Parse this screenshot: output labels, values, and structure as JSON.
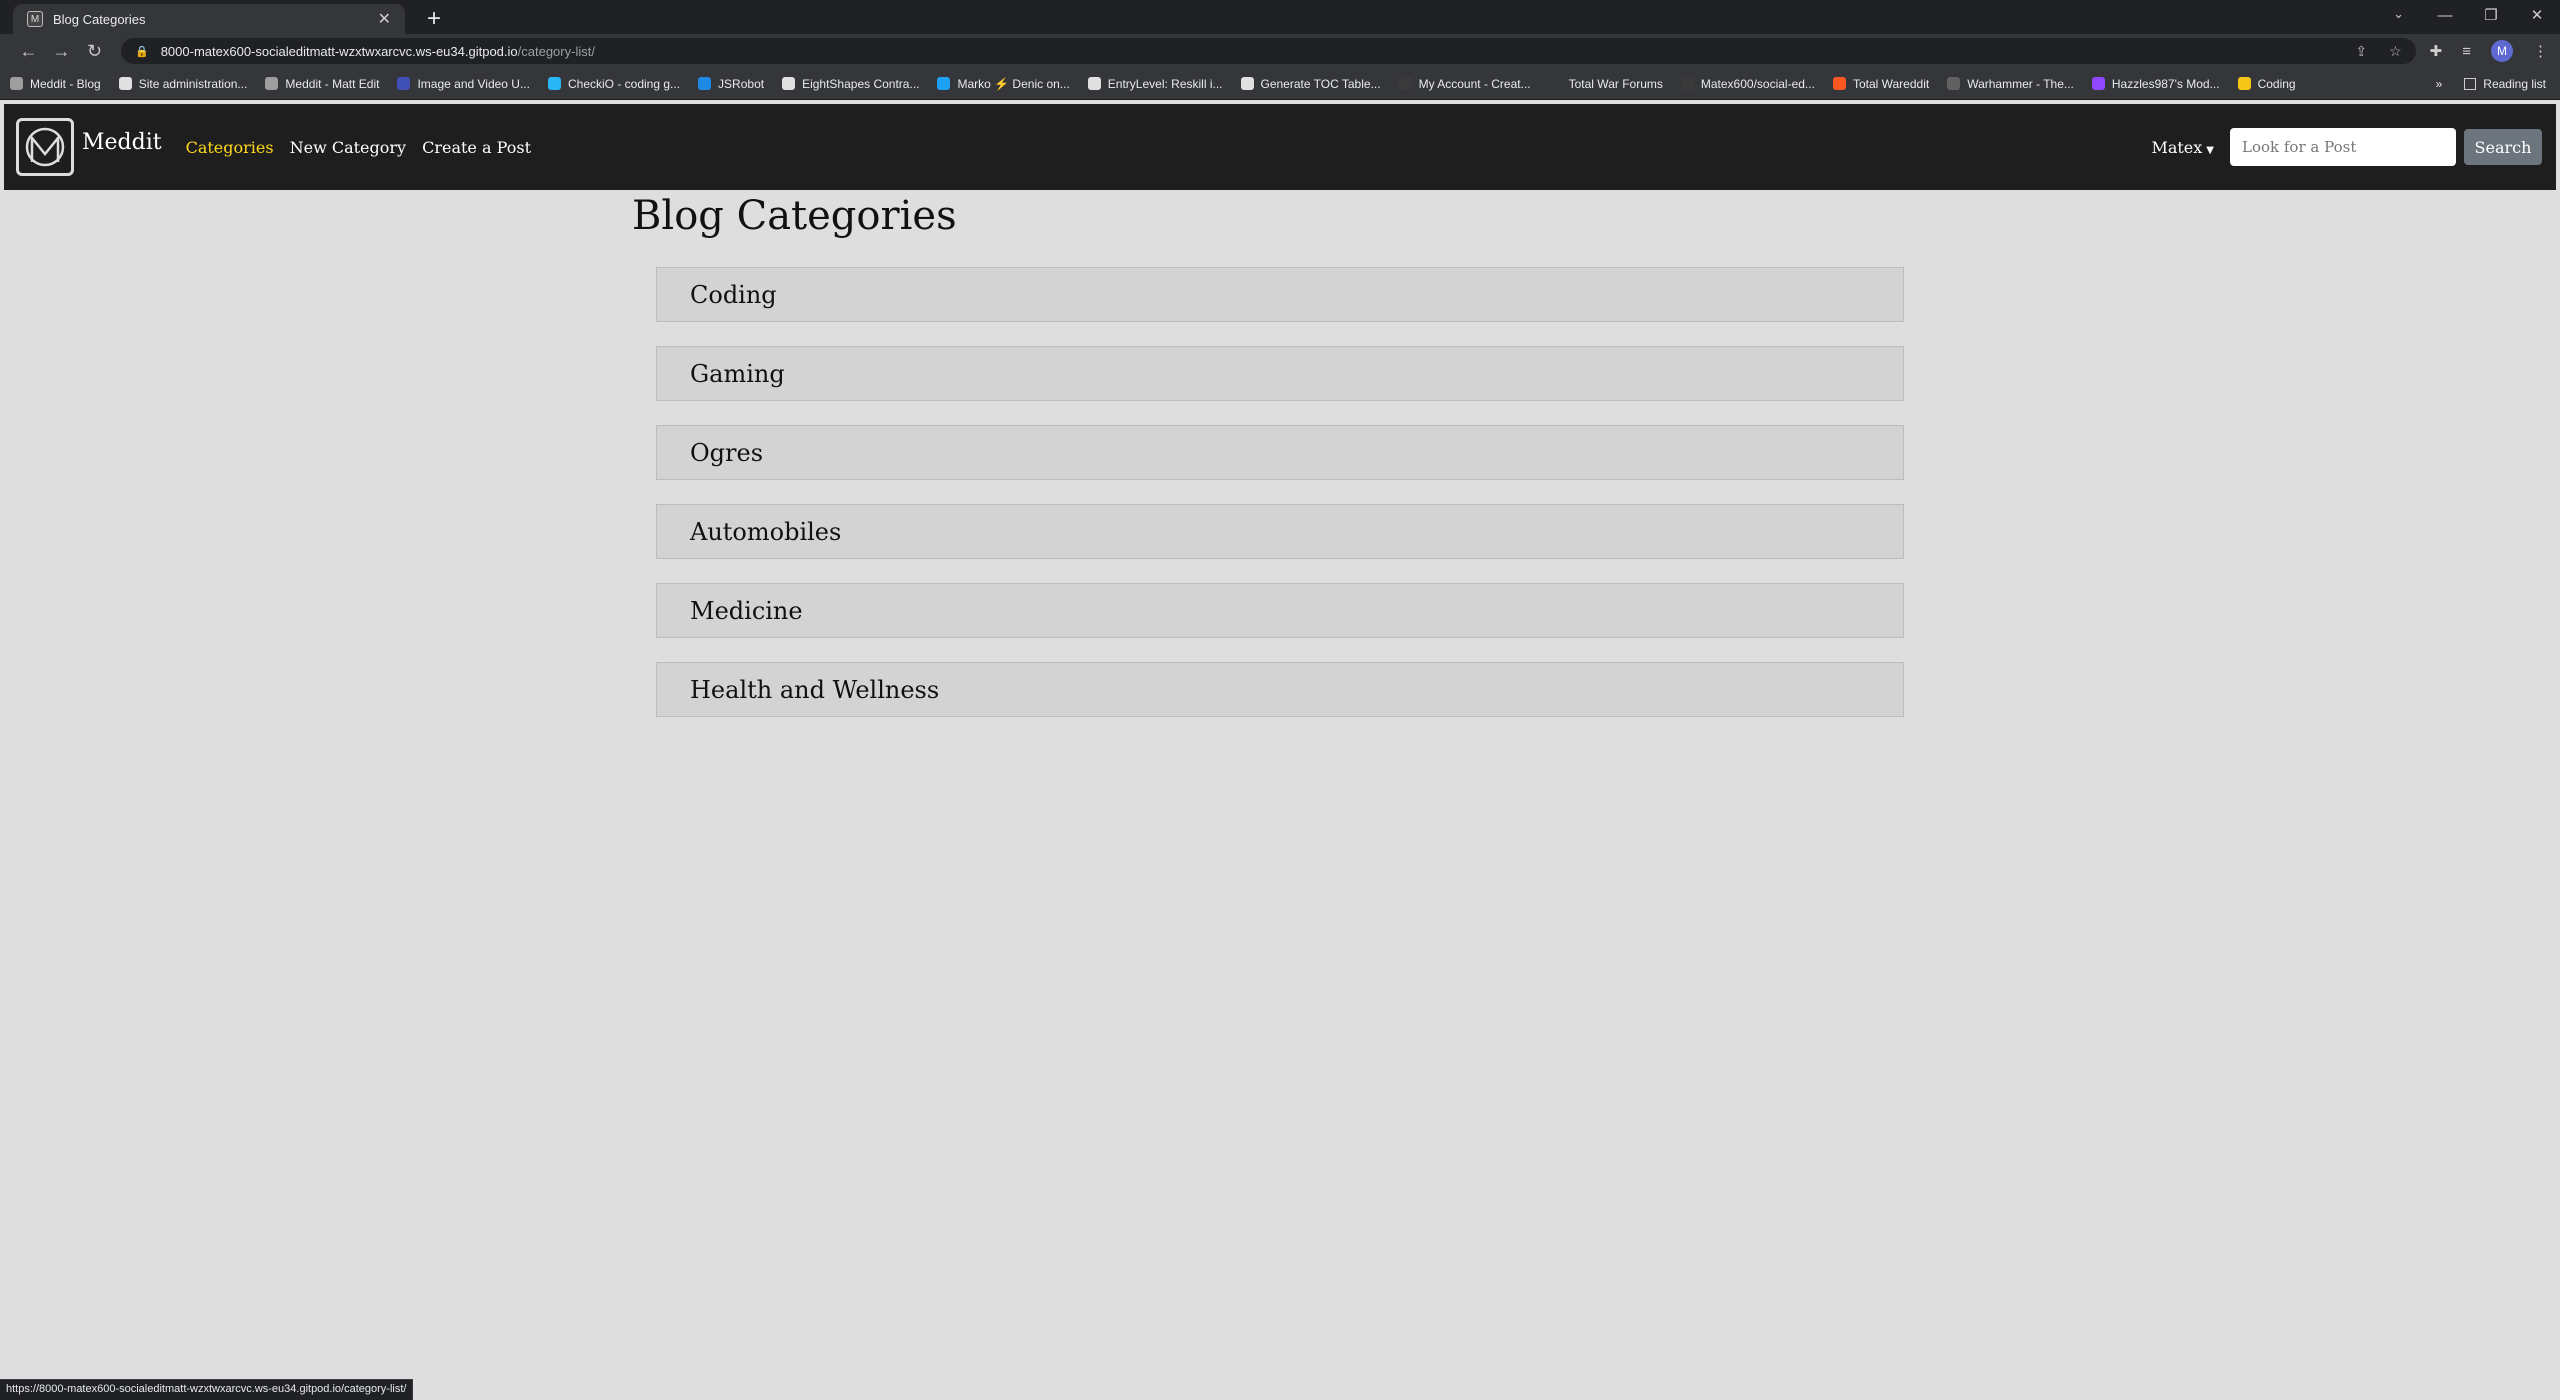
{
  "browser": {
    "tab_title": "Blog Categories",
    "tab_favicon": "M",
    "url_host": "8000-matex600-socialeditmatt-wzxtwxarcvc.ws-eu34.gitpod.io",
    "url_path": "/category-list/",
    "profile_initial": "M",
    "reading_list": "Reading list",
    "bookmarks_overflow": "»",
    "bookmarks": [
      {
        "label": "Meddit - Blog",
        "color": "#9e9e9e"
      },
      {
        "label": "Site administration...",
        "color": "#e0e0e0"
      },
      {
        "label": "Meddit - Matt Edit",
        "color": "#9e9e9e"
      },
      {
        "label": "Image and Video U...",
        "color": "#3f51b5"
      },
      {
        "label": "CheckiO - coding g...",
        "color": "#29b6f6"
      },
      {
        "label": "JSRobot",
        "color": "#1e88e5"
      },
      {
        "label": "EightShapes Contra...",
        "color": "#e0e0e0"
      },
      {
        "label": "Marko ⚡ Denic on...",
        "color": "#1da1f2"
      },
      {
        "label": "EntryLevel: Reskill i...",
        "color": "#e0e0e0"
      },
      {
        "label": "Generate TOC Table...",
        "color": "#e0e0e0"
      },
      {
        "label": "My Account - Creat...",
        "color": "#3a3a3a"
      },
      {
        "label": "Total War Forums",
        "color": "#35363a"
      },
      {
        "label": "Matex600/social-ed...",
        "color": "#3a3a3a"
      },
      {
        "label": "Total Wareddit",
        "color": "#ff5722"
      },
      {
        "label": "Warhammer - The...",
        "color": "#616161"
      },
      {
        "label": "Hazzles987's Mod...",
        "color": "#9146ff"
      },
      {
        "label": "Coding",
        "color": "#f5c518"
      }
    ],
    "status_url": "https://8000-matex600-socialeditmatt-wzxtwxarcvc.ws-eu34.gitpod.io/category-list/"
  },
  "site": {
    "brand": "Meddit",
    "nav": {
      "categories": "Categories",
      "new_category": "New Category",
      "create_post": "Create a Post"
    },
    "user": "Matex",
    "search_placeholder": "Look for a Post",
    "search_button": "Search",
    "active_color": "#ffd91a"
  },
  "page": {
    "title": "Blog Categories",
    "categories": [
      "Coding",
      "Gaming",
      "Ogres",
      "Automobiles",
      "Medicine",
      "Health and Wellness"
    ]
  }
}
